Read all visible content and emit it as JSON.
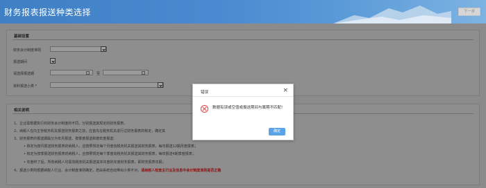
{
  "header": {
    "title": "财务报表报送种类选择",
    "next_label": "下一步"
  },
  "basic": {
    "title": "基础设置",
    "fields": [
      {
        "label": "财务会计制度准则"
      },
      {
        "label": "报送期间"
      },
      {
        "label": "请选择报送期",
        "separator": "至"
      },
      {
        "label": "资料报送小类 *"
      }
    ]
  },
  "notes": {
    "title": "相关说明",
    "lines": [
      "1、企业需根据执行的财务会计制度的不同，分别报送其规定的财务报表。",
      "2、纳税人在向主管税务机关报送财务报表之前，应首先在税务机关进行过财务报表的核定，确定其",
      "3、财务报表的报送期属分为年月报送、按季度报送和按年度报送：",
      "• 核定为按月报送财务报表的纳税人，应按照规定每个月度向税务机关报送其财务报表，每年报送12期月度报表；",
      "• 核定为按季报送财务报表的纳税人，应按照规定每个季度向税务机关报送其财务报表，每年报送4期季度报表；",
      "• 年度终了后，所有纳税人均需向税务机关报送其本年度的年度财务报表，即财务报表年报；",
      "4、报送小类则根据纳税人行业、会计制度准则确定，若由系统自动带出小类不对，"
    ],
    "red_text": "请纳税人检查主行业及信息中会计制度准则是否正确"
  },
  "dialog": {
    "title": "错误",
    "close": "×",
    "message": "数据有误或空值或报送期间与属期不匹配!",
    "ok_label": "确定"
  },
  "colors": {
    "header": "#4b8ad0",
    "ok_button": "#5aa3e6",
    "error_icon": "#e04343"
  }
}
